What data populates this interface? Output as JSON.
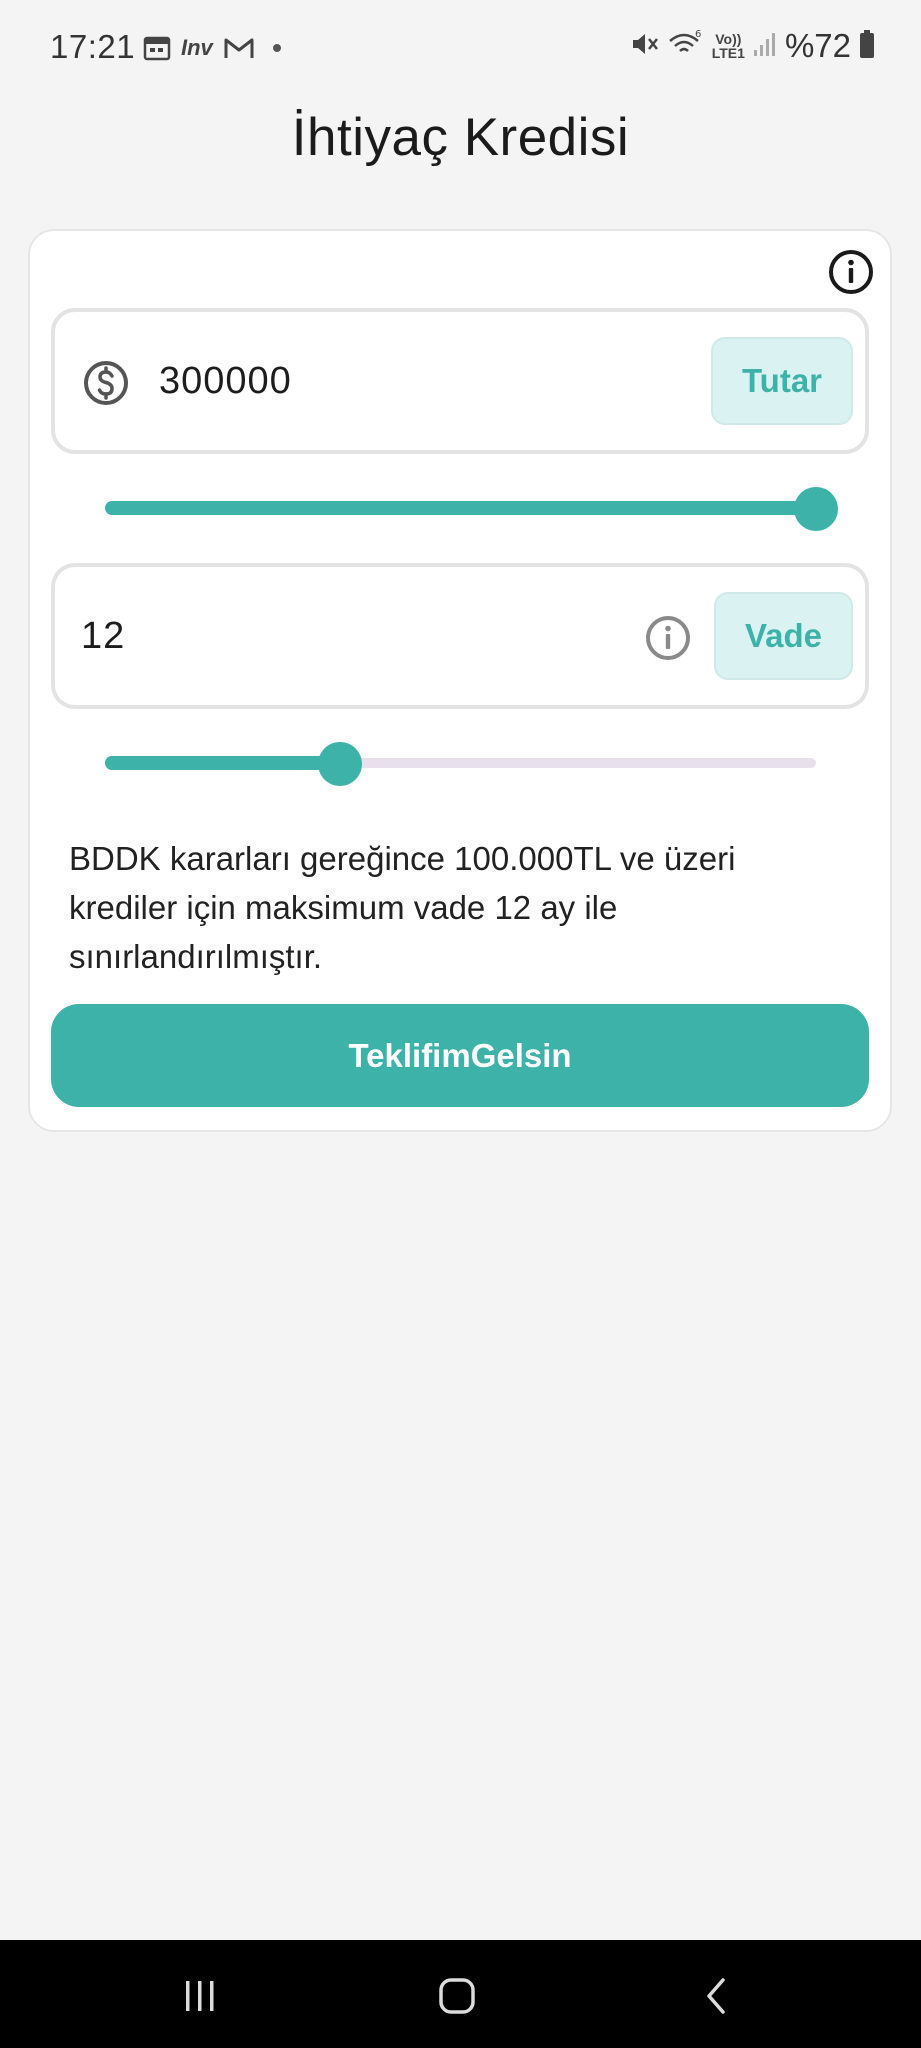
{
  "status_bar": {
    "time": "17:21",
    "left_icons": [
      "calendar-icon",
      "inv-app-icon",
      "gmail-icon",
      "notification-dot"
    ],
    "inv_label": "Inv",
    "network_label_top": "Vo))",
    "network_label_bottom": "LTE1",
    "wifi_badge": "6",
    "battery": "%72"
  },
  "header": {
    "title": "İhtiyaç Kredisi"
  },
  "form": {
    "amount": {
      "value": "300000",
      "button_label": "Tutar",
      "icon": "dollar-circle-icon",
      "slider_level": 1.0
    },
    "term": {
      "value": "12",
      "button_label": "Vade",
      "icon": "info-icon",
      "slider_level": 0.33
    },
    "note": "BDDK kararları gereğince 100.000TL ve üzeri krediler için maksimum vade 12 ay ile sınırlandırılmıştır.",
    "submit_label": "TeklifimGelsin"
  },
  "colors": {
    "accent": "#3db2a8",
    "accent_light": "#daf3f2",
    "track_inactive": "#e8e0ec",
    "background": "#f4f4f4"
  },
  "nav_bar": {
    "buttons": [
      "recents-icon",
      "home-icon",
      "back-icon"
    ]
  }
}
